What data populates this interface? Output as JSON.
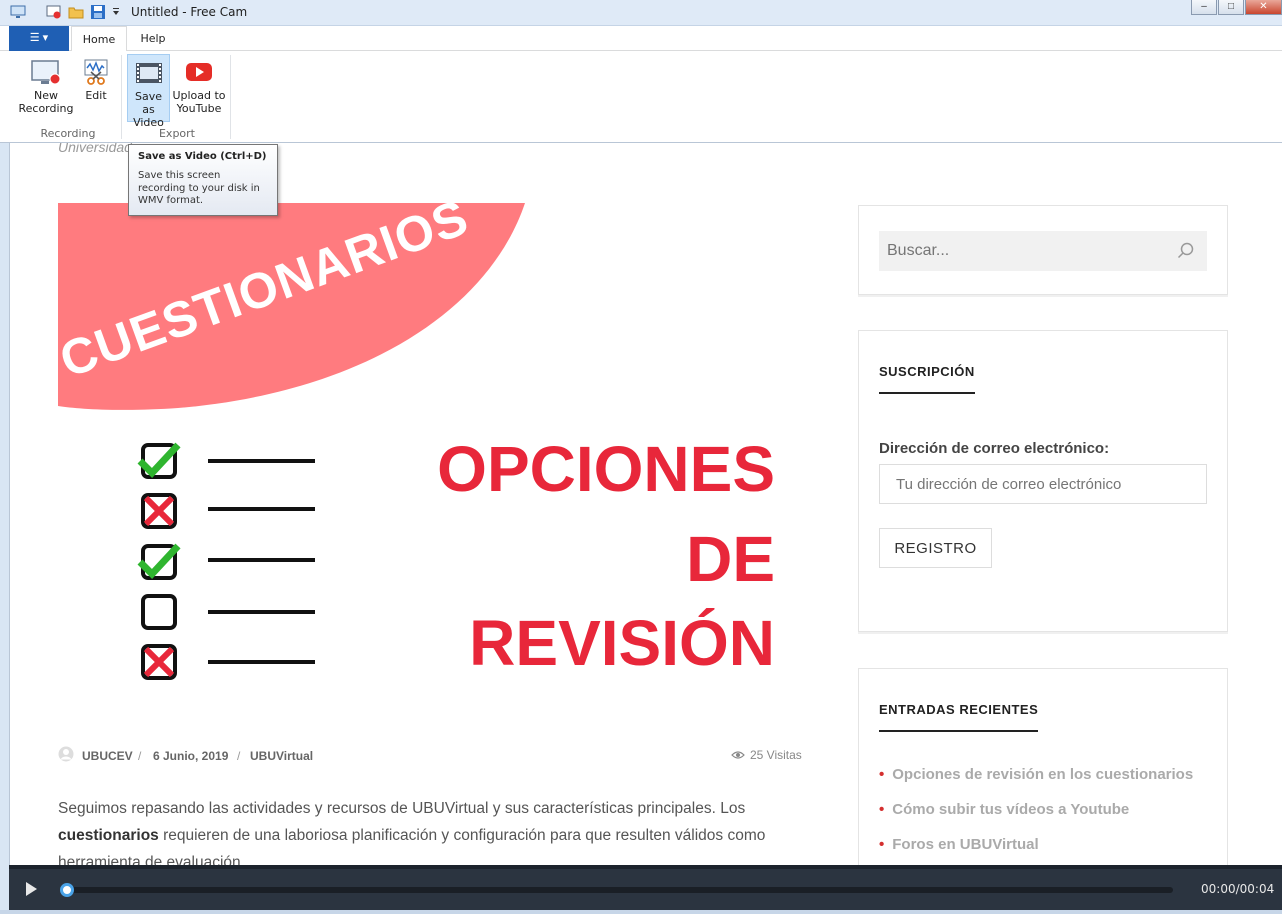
{
  "window": {
    "title": "Untitled - Free Cam",
    "minimize": "–",
    "maximize": "□",
    "close": "✕"
  },
  "ribbon": {
    "file_icon": "☰ ▾",
    "tabs": [
      "Home",
      "Help"
    ],
    "buttons": {
      "new_recording": [
        "New",
        "Recording"
      ],
      "edit": "Edit",
      "save_as_video": [
        "Save as",
        "Video"
      ],
      "upload_youtube": [
        "Upload to",
        "YouTube"
      ]
    },
    "groups": [
      "Recording",
      "Export"
    ]
  },
  "tooltip": {
    "title": "Save as Video (Ctrl+D)",
    "body": "Save this screen recording to your disk in WMV format."
  },
  "webpage": {
    "cut_text": "Universidad",
    "hero": {
      "banner": "CUESTIONARIOS",
      "line1": "OPCIONES",
      "line2": "DE",
      "line3": "REVISIÓN"
    },
    "meta": {
      "author": "UBUCEV",
      "date": "6 Junio, 2019",
      "category": "UBUVirtual",
      "views": "25 Visitas",
      "sep": "/"
    },
    "body": {
      "part1": "Seguimos repasando las actividades y recursos de UBUVirtual y sus características principales. Los ",
      "bold": "cuestionarios",
      "part2": " requieren de una laboriosa planificación y configuración para que resulten válidos como herramienta de evaluación."
    },
    "sidebar": {
      "search_placeholder": "Buscar...",
      "subscription_title": "SUSCRIPCIÓN",
      "email_label": "Dirección de correo electrónico:",
      "email_placeholder": "Tu dirección de correo electrónico",
      "register_button": "REGISTRO",
      "recent_title": "ENTRADAS RECIENTES",
      "recent": [
        "Opciones de revisión en los cuestionarios",
        "Cómo subir tus vídeos a Youtube",
        "Foros en UBUVirtual"
      ]
    }
  },
  "player": {
    "timecode": "00:00/00:04",
    "progress": 0
  },
  "colors": {
    "accent_blue": "#1f5fb4",
    "banner_pink": "#ff7b7f",
    "title_red": "#e8273a",
    "check_green": "#2fb52f"
  }
}
